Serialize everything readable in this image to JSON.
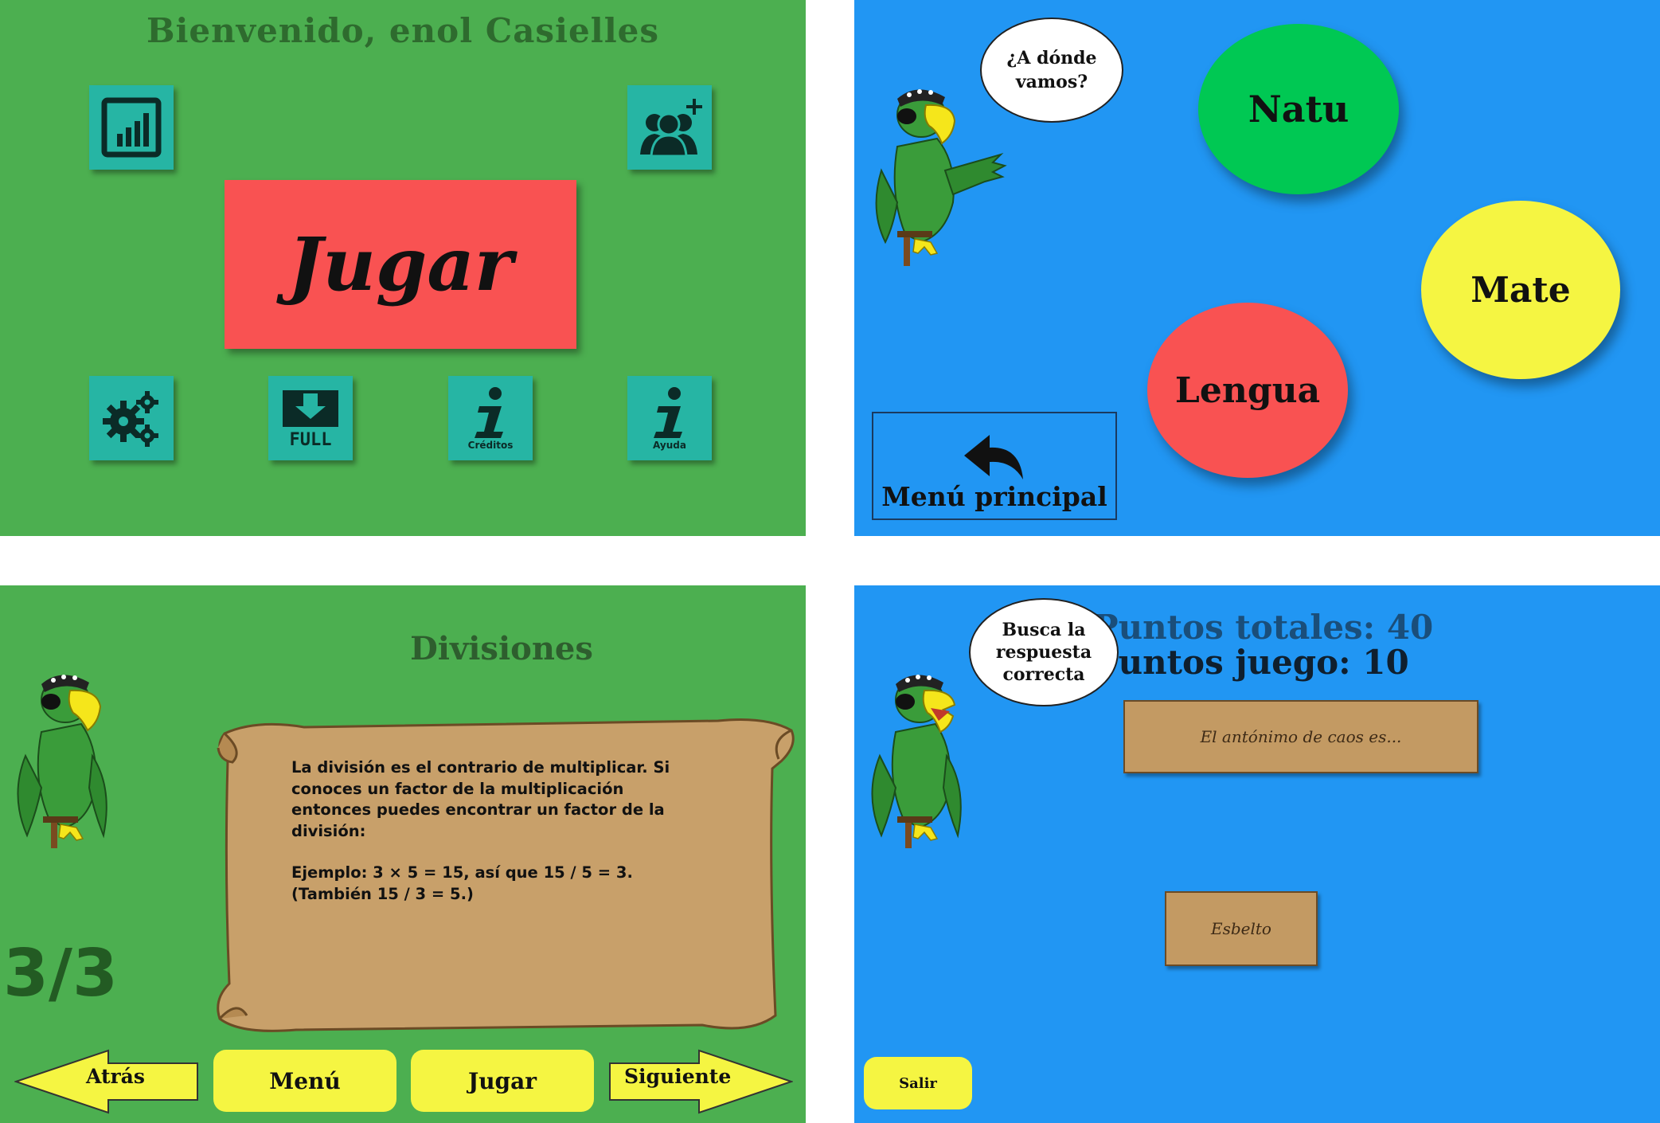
{
  "panel_welcome": {
    "title": "Bienvenido, enol Casielles",
    "play_label": "Jugar",
    "tiles": [
      {
        "icon": "chart-icon",
        "caption": ""
      },
      {
        "icon": "add-user-icon",
        "caption": ""
      },
      {
        "icon": "gears-icon",
        "caption": ""
      },
      {
        "icon": "download-icon",
        "caption": "FULL"
      },
      {
        "icon": "info-icon",
        "caption": "Créditos"
      },
      {
        "icon": "info-icon",
        "caption": "Ayuda"
      }
    ],
    "colors": {
      "background": "#4caf50",
      "tile": "#26b5a4",
      "play": "#f95252"
    }
  },
  "panel_subjects": {
    "speech": "¿A dónde vamos?",
    "subjects": [
      {
        "label": "Natu",
        "color": "#00c853"
      },
      {
        "label": "Mate",
        "color": "#f5f542"
      },
      {
        "label": "Lengua",
        "color": "#f95252"
      }
    ],
    "back_label": "Menú principal",
    "back_icon": "undo-arrow-icon",
    "colors": {
      "background": "#2196f3"
    }
  },
  "panel_lesson": {
    "title": "Divisiones",
    "paragraph1": "La división es el contrario de multiplicar. Si conoces un factor de la multiplicación entonces puedes encontrar un factor de la división:",
    "paragraph2": "Ejemplo: 3 × 5 = 15, así que 15 / 5 = 3. (También 15 / 3 = 5.)",
    "page_counter": "3/3",
    "buttons": {
      "back": "Atrás",
      "menu": "Menú",
      "play": "Jugar",
      "next": "Siguiente"
    }
  },
  "panel_quiz": {
    "speech": "Busca la respuesta correcta",
    "total_points": "Puntos totales: 40",
    "game_points": "Puntos juego: 10",
    "question": "El antónimo de caos es...",
    "answer": "Esbelto",
    "exit_label": "Salir"
  }
}
